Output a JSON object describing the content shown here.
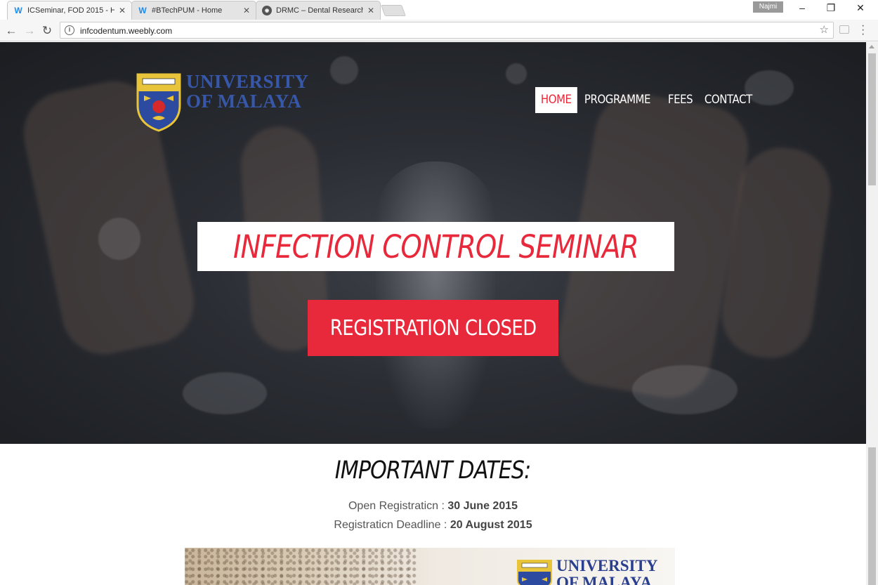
{
  "browser": {
    "tabs": [
      {
        "title": "ICSeminar, FOD 2015 - H",
        "icon": "weebly-icon"
      },
      {
        "title": "#BTechPUM - Home",
        "icon": "weebly-icon"
      },
      {
        "title": "DRMC – Dental Research",
        "icon": "drmc-icon"
      }
    ],
    "user": "Najmi",
    "url": "infcodentum.weebly.com"
  },
  "site": {
    "logo_line1": "UNIVERSITY",
    "logo_line2": "OF MALAYA",
    "nav": [
      "HOME",
      "PROGRAMME",
      "FEES",
      "CONTACT"
    ],
    "hero_title": "INFECTION CONTROL SEMINAR",
    "cta": "REGISTRATION CLOSED"
  },
  "dates": {
    "heading": "IMPORTANT DATES:",
    "open_label": "Open Registraticn :",
    "open_value": "30 June 2015",
    "deadline_label": "Registraticn Deadline :",
    "deadline_value": "20 August 2015"
  },
  "banner": {
    "line1": "UNIVERSITY",
    "line2": "OF MALAYA"
  },
  "colors": {
    "accent": "#e8293b",
    "brand_blue": "#3757a8"
  }
}
